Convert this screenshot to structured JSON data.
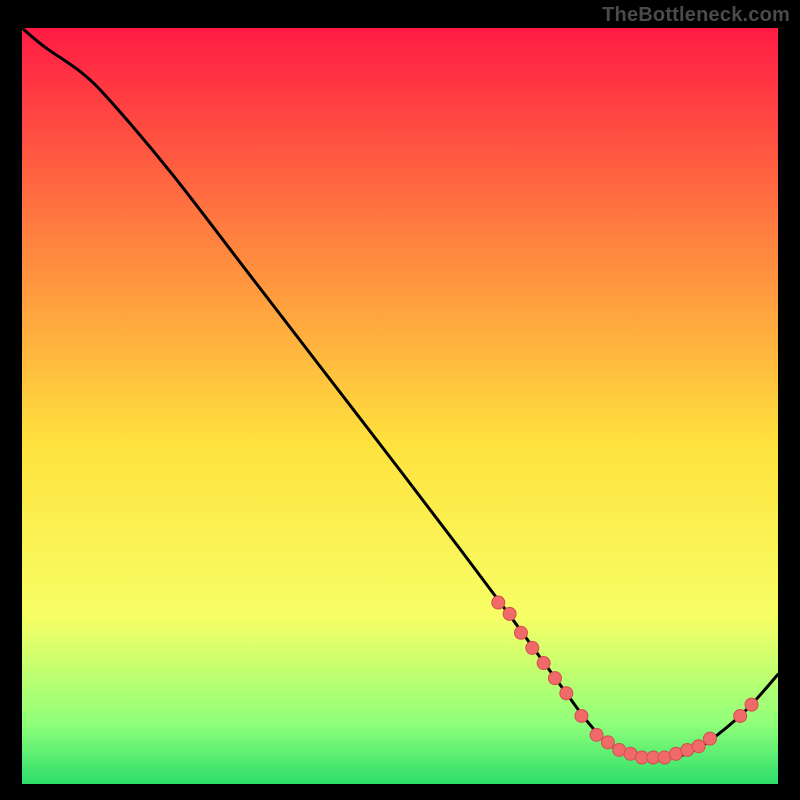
{
  "watermark": "TheBottleneck.com",
  "colors": {
    "background": "#000000",
    "grad_top": "#ff1b44",
    "grad_midtop": "#ff823f",
    "grad_mid": "#ffe23e",
    "grad_mlow": "#f7ff66",
    "grad_low": "#8fff7a",
    "grad_bottom": "#2dde6a",
    "curve": "#000000",
    "marker_fill": "#f06a6a",
    "marker_stroke": "#d44e4e"
  },
  "chart_data": {
    "type": "line",
    "title": "",
    "xlabel": "",
    "ylabel": "",
    "xlim": [
      0,
      100
    ],
    "ylim": [
      0,
      100
    ],
    "series": [
      {
        "name": "curve",
        "x": [
          0.0,
          3.0,
          8.0,
          12.0,
          20.0,
          30.0,
          40.0,
          50.0,
          58.0,
          64.0,
          68.0,
          72.0,
          75.0,
          78.0,
          82.0,
          86.0,
          89.0,
          92.0,
          96.0,
          100.0
        ],
        "y": [
          100.0,
          97.5,
          94.0,
          90.0,
          80.5,
          67.5,
          54.5,
          41.5,
          31.0,
          23.0,
          17.5,
          12.0,
          8.0,
          5.0,
          3.5,
          3.5,
          4.5,
          6.5,
          10.0,
          14.5
        ]
      }
    ],
    "markers": [
      {
        "x": 63.0,
        "y": 24.0
      },
      {
        "x": 64.5,
        "y": 22.5
      },
      {
        "x": 66.0,
        "y": 20.0
      },
      {
        "x": 67.5,
        "y": 18.0
      },
      {
        "x": 69.0,
        "y": 16.0
      },
      {
        "x": 70.5,
        "y": 14.0
      },
      {
        "x": 72.0,
        "y": 12.0
      },
      {
        "x": 74.0,
        "y": 9.0
      },
      {
        "x": 76.0,
        "y": 6.5
      },
      {
        "x": 77.5,
        "y": 5.5
      },
      {
        "x": 79.0,
        "y": 4.5
      },
      {
        "x": 80.5,
        "y": 4.0
      },
      {
        "x": 82.0,
        "y": 3.5
      },
      {
        "x": 83.5,
        "y": 3.5
      },
      {
        "x": 85.0,
        "y": 3.5
      },
      {
        "x": 86.5,
        "y": 4.0
      },
      {
        "x": 88.0,
        "y": 4.5
      },
      {
        "x": 89.5,
        "y": 5.0
      },
      {
        "x": 91.0,
        "y": 6.0
      },
      {
        "x": 95.0,
        "y": 9.0
      },
      {
        "x": 96.5,
        "y": 10.5
      }
    ]
  }
}
